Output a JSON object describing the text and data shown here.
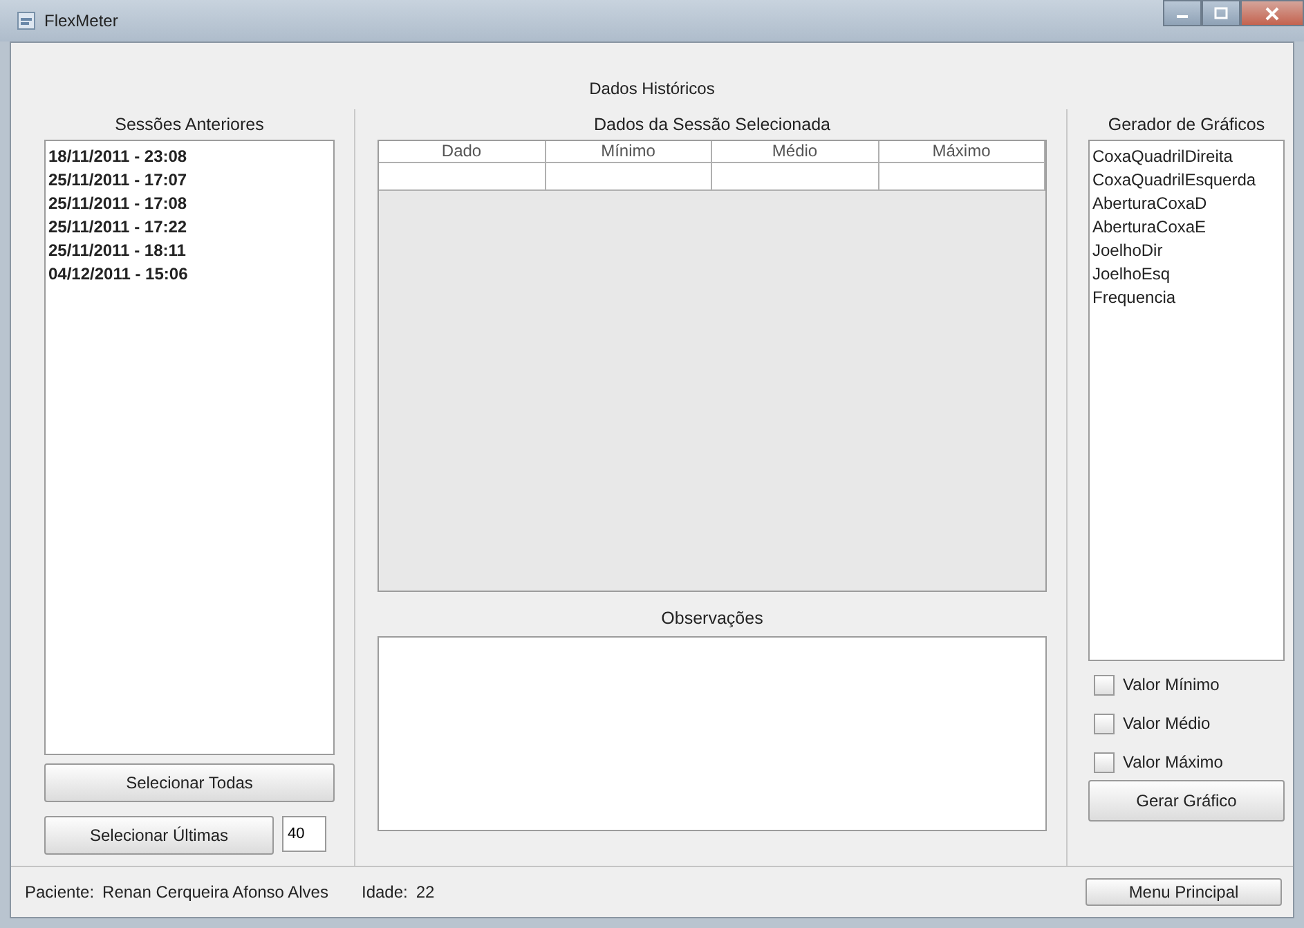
{
  "window": {
    "title": "FlexMeter"
  },
  "heading": "Dados Históricos",
  "sessions": {
    "title": "Sessões Anteriores",
    "items": [
      {
        "label": "18/11/2011 - 23:08",
        "selected": false
      },
      {
        "label": "25/11/2011 - 17:07",
        "selected": false
      },
      {
        "label": "25/11/2011 - 17:08",
        "selected": false
      },
      {
        "label": "25/11/2011 - 17:22",
        "selected": false
      },
      {
        "label": "25/11/2011 - 18:11",
        "selected": false
      },
      {
        "label": "04/12/2011 - 15:06",
        "selected": false
      }
    ],
    "select_all_button": "Selecionar Todas",
    "select_last_button": "Selecionar Últimas",
    "last_count": "40"
  },
  "session_data": {
    "title": "Dados da Sessão Selecionada",
    "table": {
      "columns": [
        "Dado",
        "Mínimo",
        "Médio",
        "Máximo"
      ]
    },
    "notes_title": "Observações"
  },
  "chart_generator": {
    "title": "Gerador de Gráficos",
    "items": [
      {
        "label": "CoxaQuadrilDireita",
        "selected": false
      },
      {
        "label": "CoxaQuadrilEsquerda",
        "selected": false
      },
      {
        "label": "AberturaCoxaD",
        "selected": false
      },
      {
        "label": "AberturaCoxaE",
        "selected": false
      },
      {
        "label": "JoelhoDir",
        "selected": false
      },
      {
        "label": "JoelhoEsq",
        "selected": false
      },
      {
        "label": "Frequencia",
        "selected": false
      }
    ],
    "options": [
      {
        "label": "Valor Mínimo",
        "checked": false
      },
      {
        "label": "Valor Médio",
        "checked": false
      },
      {
        "label": "Valor Máximo",
        "checked": false
      }
    ],
    "generate_button": "Gerar Gráfico"
  },
  "status_bar": {
    "patient_label": "Paciente:",
    "patient_name": "Renan Cerqueira Afonso Alves",
    "age_label": "Idade:",
    "age": "22",
    "menu_button": "Menu Principal"
  }
}
